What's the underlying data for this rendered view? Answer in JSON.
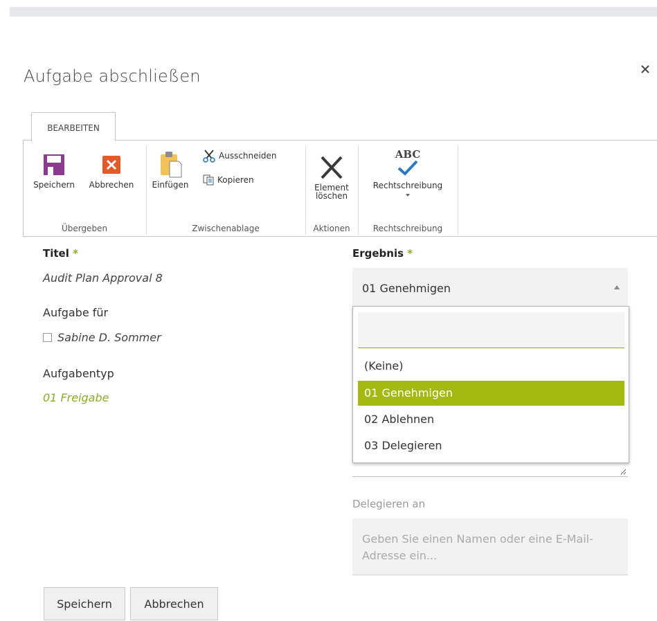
{
  "dialog": {
    "title": "Aufgabe abschließen"
  },
  "ribbon": {
    "tab": "BEARBEITEN",
    "groups": {
      "submit": {
        "label": "Übergeben",
        "save": "Speichern",
        "cancel": "Abbrechen"
      },
      "clipboard": {
        "label": "Zwischenablage",
        "paste": "Einfügen",
        "cut": "Ausschneiden",
        "copy": "Kopieren"
      },
      "actions": {
        "label": "Aktionen",
        "delete_line1": "Element",
        "delete_line2": "löschen"
      },
      "spelling": {
        "label": "Rechtschreibung",
        "button": "Rechtschreibung",
        "abc": "ABC"
      }
    }
  },
  "form": {
    "title_label": "Titel",
    "required_mark": "*",
    "title_value": "Audit Plan Approval 8",
    "assigned_label": "Aufgabe für",
    "assigned_value": "Sabine D. Sommer",
    "tasktype_label": "Aufgabentyp",
    "tasktype_value": "01 Freigabe",
    "result_label": "Ergebnis",
    "result_selected": "01 Genehmigen",
    "result_options": [
      "(Keine)",
      "01 Genehmigen",
      "02 Ablehnen",
      "03 Delegieren"
    ],
    "delegate_label": "Delegieren an",
    "delegate_placeholder": "Geben Sie einen Namen oder eine E-Mail-Adresse ein..."
  },
  "footer": {
    "save": "Speichern",
    "cancel": "Abbrechen"
  },
  "colors": {
    "accent": "#a3b910",
    "required": "#8dab2b",
    "save_icon": "#8b3a8f",
    "cancel_icon": "#e05a2a",
    "check": "#2b79c2"
  }
}
